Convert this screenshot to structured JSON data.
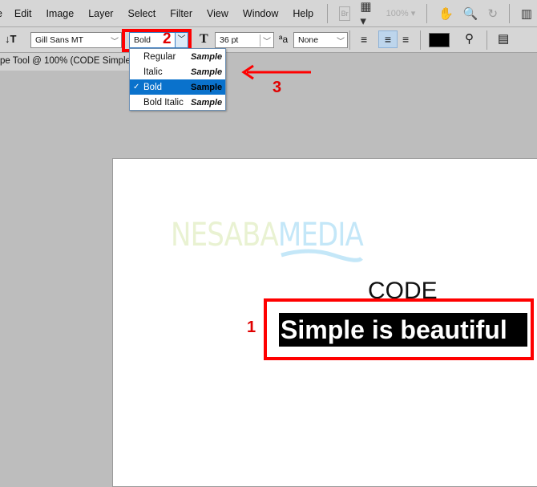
{
  "menubar": {
    "items": [
      "Edit",
      "Image",
      "Layer",
      "Select",
      "Filter",
      "View",
      "Window",
      "Help"
    ],
    "bridge": "Br",
    "zoom": "100%"
  },
  "options": {
    "font_family": "Gill Sans MT",
    "font_style": "Bold",
    "font_size": "36 pt",
    "anti_alias": "None",
    "color": "#000000"
  },
  "doc_tab": {
    "title": "pe Tool @ 100% (CODE Simple is"
  },
  "dropdown": {
    "items": [
      {
        "label": "Regular",
        "sample": "Sample",
        "selected": false
      },
      {
        "label": "Italic",
        "sample": "Sample",
        "selected": false
      },
      {
        "label": "Bold",
        "sample": "Sample",
        "selected": true
      },
      {
        "label": "Bold Italic",
        "sample": "Sample",
        "selected": false
      }
    ],
    "check": "✓"
  },
  "canvas": {
    "watermark_left": "NESABA",
    "watermark_right": "MEDIA",
    "heading": "CODE",
    "selected_text": "Simple is beautiful"
  },
  "annotations": {
    "one": "1",
    "two": "2",
    "three": "3",
    "color": "#ff0000"
  }
}
